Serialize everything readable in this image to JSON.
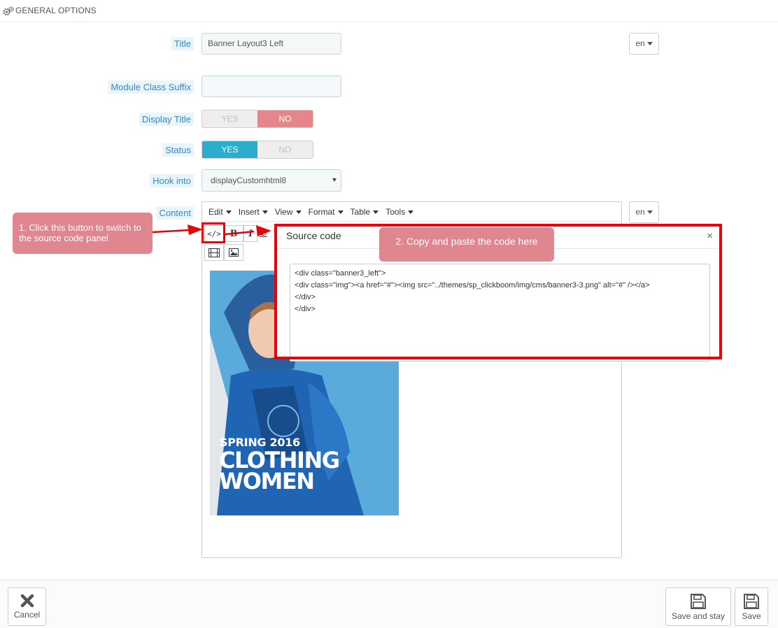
{
  "header": {
    "title": "GENERAL OPTIONS",
    "icon": "gears-icon"
  },
  "fields": {
    "title": {
      "label": "Title",
      "value": "Banner Layout3 Left",
      "lang": "en"
    },
    "module_class_suffix": {
      "label": "Module Class Suffix",
      "value": ""
    },
    "display_title": {
      "label": "Display Title",
      "yes": "YES",
      "no": "NO",
      "selected": "NO"
    },
    "status": {
      "label": "Status",
      "yes": "YES",
      "no": "NO",
      "selected": "YES"
    },
    "hook_into": {
      "label": "Hook into",
      "value": "displayCustomhtml8"
    },
    "content": {
      "label": "Content",
      "lang": "en"
    }
  },
  "editor": {
    "menus": [
      "Edit",
      "Insert",
      "View",
      "Format",
      "Table",
      "Tools"
    ],
    "toolbar": {
      "source_code": "</>",
      "bold": "B",
      "italic": "I",
      "underline": "U"
    },
    "banner": {
      "line1": "SPRING 2016",
      "line2": "CLOTHING",
      "line3": "WOMEN"
    }
  },
  "modal": {
    "title": "Source code",
    "close": "×",
    "code": "<div class=\"banner3_left\">\n<div class=\"img\"><a href=\"#\"><img src=\"../themes/sp_clickboom/img/cms/banner3-3.png\" alt=\"#\" /></a>\n</div>\n</div>"
  },
  "callouts": {
    "step1": "1. Click this button to switch to the source code panel",
    "step2": "2. Copy and paste the code here"
  },
  "colors": {
    "label_bg": "#eaf4fb",
    "label_text": "#3a86c8",
    "yes_active": "#2eacce",
    "no_active": "#e5868c",
    "highlight": "#e8000b",
    "callout_bg": "#e0868e"
  },
  "footer": {
    "cancel": "Cancel",
    "save_and_stay": "Save and stay",
    "save": "Save"
  }
}
